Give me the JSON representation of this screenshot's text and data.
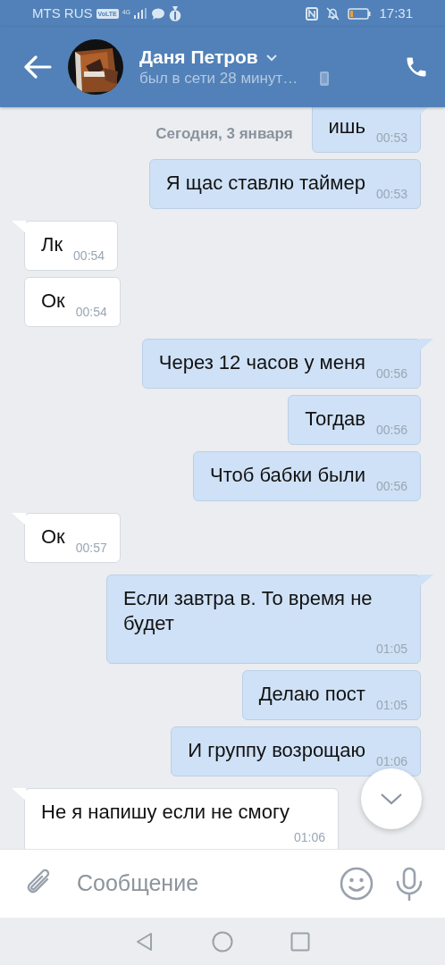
{
  "status_bar": {
    "carrier": "MTS RUS",
    "volte": "VoLTE",
    "network": "4G",
    "time": "17:31"
  },
  "header": {
    "name": "Даня Петров",
    "status": "был в сети 28 минут…"
  },
  "date_label": "Сегодня, 3 января",
  "messages": [
    {
      "kind": "outgoing",
      "text": "ишь",
      "time": "00:53"
    },
    {
      "kind": "outgoing",
      "text": "Я щас ставлю таймер",
      "time": "00:53"
    },
    {
      "kind": "incoming",
      "text": "Лк",
      "time": "00:54"
    },
    {
      "kind": "incoming",
      "text": "Ок",
      "time": "00:54"
    },
    {
      "kind": "outgoing",
      "text": "Через 12 часов у меня",
      "time": "00:56"
    },
    {
      "kind": "outgoing",
      "text": "Тогдав",
      "time": "00:56"
    },
    {
      "kind": "outgoing",
      "text": "Чтоб бабки были",
      "time": "00:56"
    },
    {
      "kind": "incoming",
      "text": "Ок",
      "time": "00:57"
    },
    {
      "kind": "outgoing",
      "text": "Если завтра в. То время не будет",
      "time": "01:05"
    },
    {
      "kind": "outgoing",
      "text": "Делаю пост",
      "time": "01:05"
    },
    {
      "kind": "outgoing",
      "text": "И группу возрощаю",
      "time": "01:06"
    },
    {
      "kind": "incoming",
      "text": "Не я напишу если не смогу",
      "time": "01:06"
    }
  ],
  "composer": {
    "placeholder": "Сообщение"
  }
}
